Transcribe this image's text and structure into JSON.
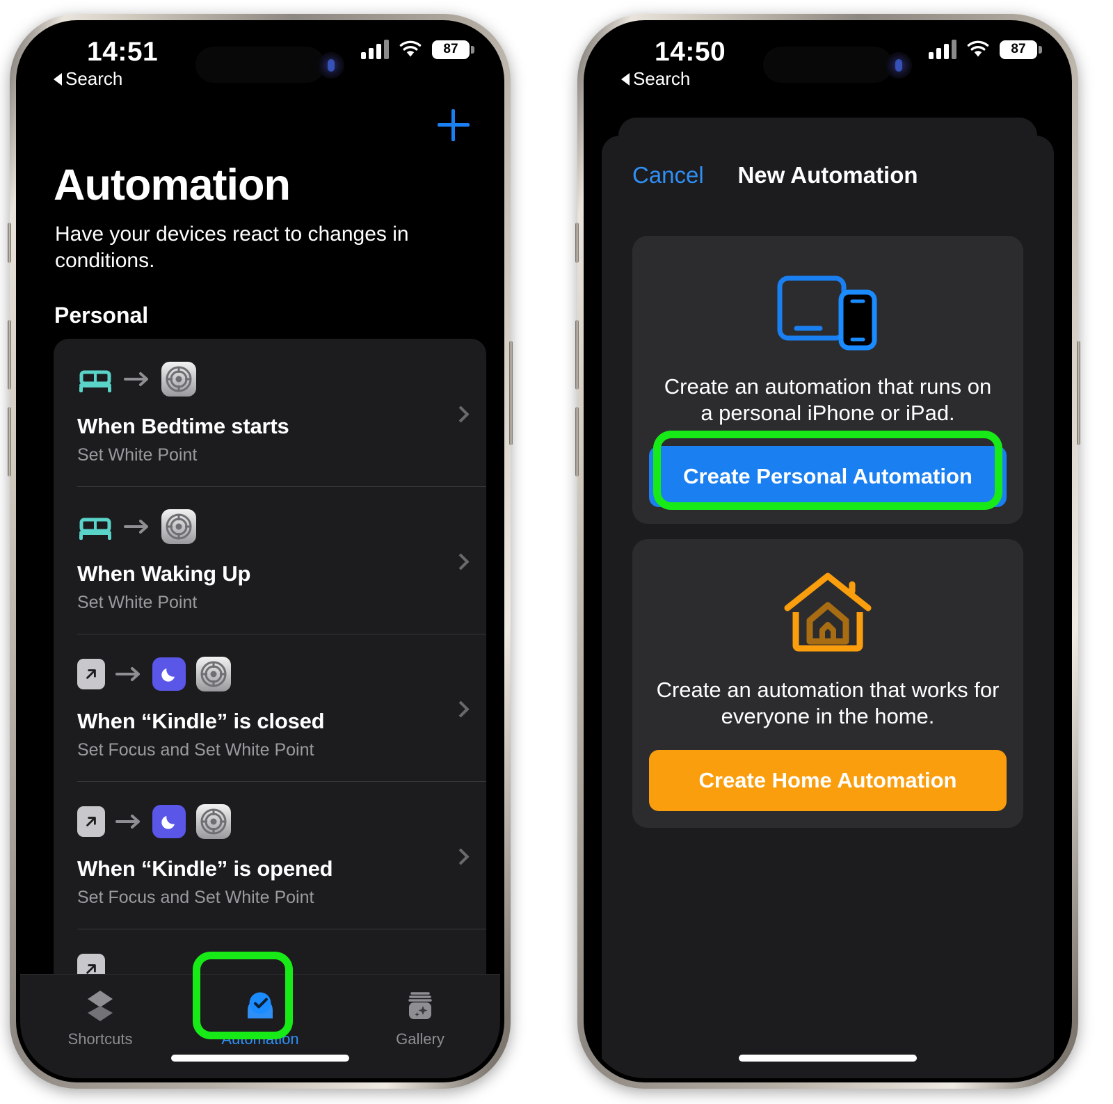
{
  "colors": {
    "accent_blue": "#1a7ff0",
    "accent_orange": "#fa9e0e",
    "highlight_green": "#18ea18",
    "focus_purple": "#5a56e8",
    "bed_teal": "#5ad4c8",
    "card_bg": "#1c1c1e",
    "inner_card_bg": "#2c2c2e"
  },
  "phone_left": {
    "status_bar": {
      "time": "14:51",
      "back_label": "Search",
      "battery": "87",
      "signal_icon": "cellular-bars-icon",
      "wifi_icon": "wifi-icon",
      "battery_icon": "battery-icon"
    },
    "header": {
      "add_icon": "plus-icon",
      "title": "Automation",
      "subtitle": "Have your devices react to changes in conditions.",
      "section": "Personal"
    },
    "automations": [
      {
        "trigger_icon": "bed-icon",
        "action_icons": [
          "settings-gear-icon"
        ],
        "title": "When Bedtime starts",
        "subtitle": "Set White Point",
        "chevron": "chevron-right-icon"
      },
      {
        "trigger_icon": "bed-icon",
        "action_icons": [
          "settings-gear-icon"
        ],
        "title": "When Waking Up",
        "subtitle": "Set White Point",
        "chevron": "chevron-right-icon"
      },
      {
        "trigger_icon": "app-open-icon",
        "action_icons": [
          "focus-moon-icon",
          "settings-gear-icon"
        ],
        "title": "When “Kindle” is closed",
        "subtitle": "Set Focus and Set White Point",
        "chevron": "chevron-right-icon"
      },
      {
        "trigger_icon": "app-open-icon",
        "action_icons": [
          "focus-moon-icon",
          "settings-gear-icon"
        ],
        "title": "When “Kindle” is opened",
        "subtitle": "Set Focus and Set White Point",
        "chevron": "chevron-right-icon"
      }
    ],
    "tab_bar": [
      {
        "label": "Shortcuts",
        "icon": "stacked-diamonds-icon",
        "active": false
      },
      {
        "label": "Automation",
        "icon": "automation-clock-icon",
        "active": true
      },
      {
        "label": "Gallery",
        "icon": "gallery-jar-icon",
        "active": false
      }
    ]
  },
  "phone_right": {
    "status_bar": {
      "time": "14:50",
      "back_label": "Search",
      "battery": "87",
      "signal_icon": "cellular-bars-icon",
      "wifi_icon": "wifi-icon",
      "battery_icon": "battery-icon"
    },
    "nav": {
      "cancel_label": "Cancel",
      "title": "New Automation"
    },
    "options": [
      {
        "icon": "ipad-iphone-devices-icon",
        "description": "Create an automation that runs on a personal iPhone or iPad.",
        "button_label": "Create Personal Automation",
        "button_color": "#1a7ff0",
        "highlighted": true
      },
      {
        "icon": "home-house-icon",
        "description": "Create an automation that works for everyone in the home.",
        "button_label": "Create Home Automation",
        "button_color": "#fa9e0e",
        "highlighted": false
      }
    ]
  }
}
